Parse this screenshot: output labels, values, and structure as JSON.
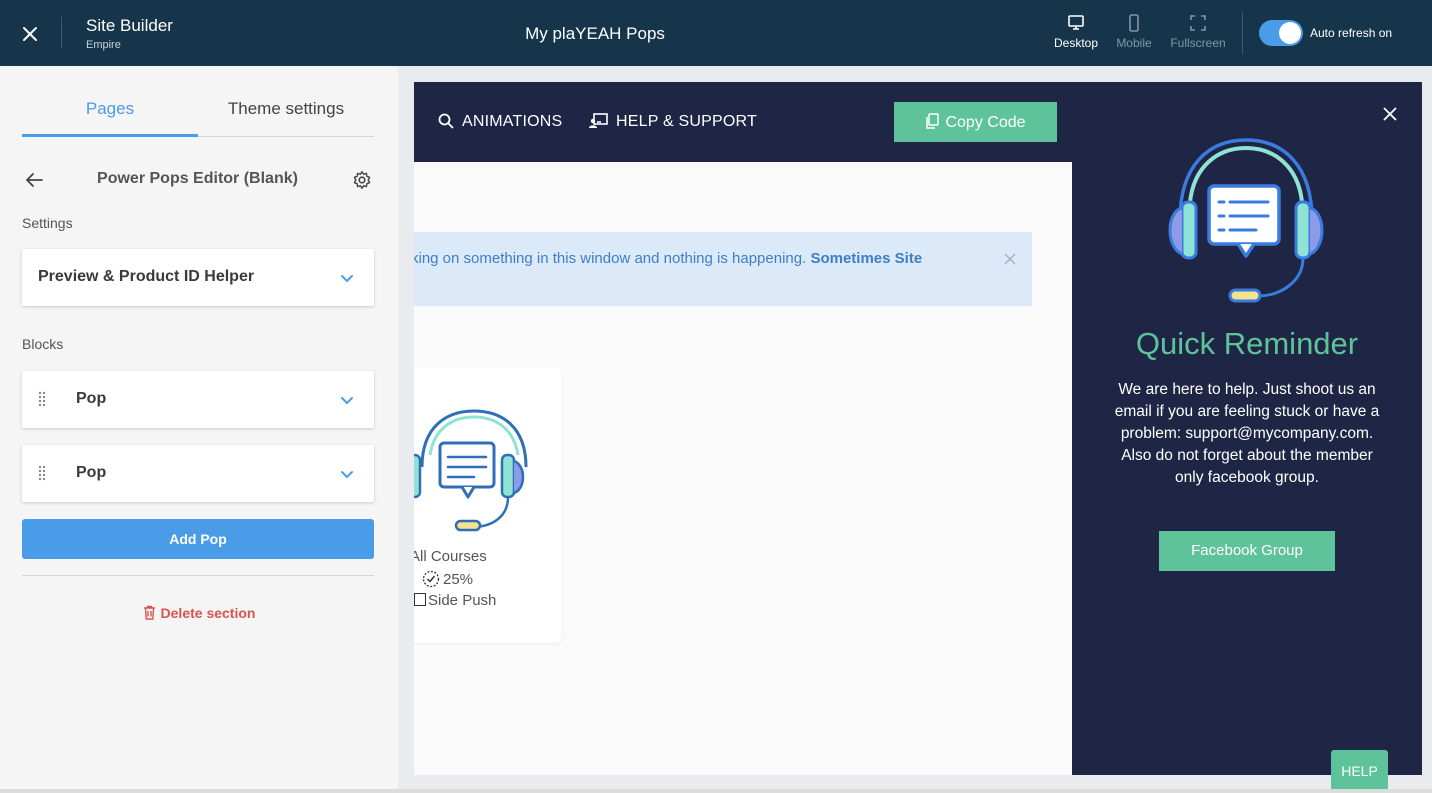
{
  "topbar": {
    "app_title": "Site Builder",
    "app_subtitle": "Empire",
    "page_title": "My plaYEAH Pops",
    "views": [
      "Desktop",
      "Mobile",
      "Fullscreen"
    ],
    "active_view": "Desktop",
    "auto_refresh_label": "Auto refresh on",
    "auto_refresh_on": true
  },
  "sidebar": {
    "tabs": [
      "Pages",
      "Theme settings"
    ],
    "active_tab": "Pages",
    "editor_title": "Power Pops Editor (Blank)",
    "settings_label": "Settings",
    "settings_items": [
      "Preview & Product ID Helper"
    ],
    "blocks_label": "Blocks",
    "blocks": [
      "Pop",
      "Pop"
    ],
    "add_button": "Add Pop",
    "delete_label": "Delete section"
  },
  "preview": {
    "nav": {
      "animations": "ANIMATIONS",
      "help_support": "HELP & SUPPORT",
      "copy_code": "Copy Code"
    },
    "notice": {
      "text": "king on something in this window and nothing is happening.",
      "bold": "Sometimes Site"
    },
    "course_card": {
      "line1": "All Courses",
      "progress": "25%",
      "line3": "Side Push"
    },
    "side_panel": {
      "title": "Quick Reminder",
      "body": "We are here to help. Just shoot us an email if you are feeling stuck or have a problem: support@mycompany.com. Also do not forget about the member only facebook group.",
      "button": "Facebook Group"
    }
  },
  "help_button": "HELP",
  "colors": {
    "topbar_bg": "#16354a",
    "accent_blue": "#4a9be8",
    "accent_green": "#5ec39b",
    "preview_navy": "#1f2645",
    "danger": "#d9534f"
  }
}
